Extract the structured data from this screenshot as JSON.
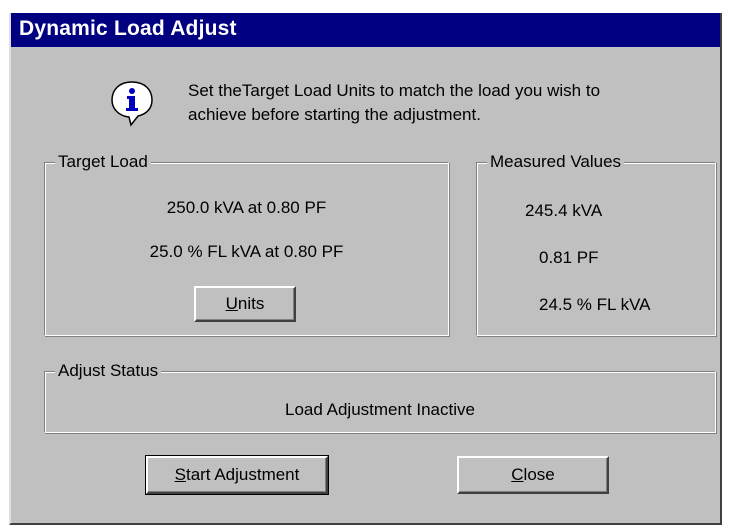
{
  "window": {
    "title": "Dynamic Load Adjust"
  },
  "instruction": {
    "icon": "info-icon",
    "line1": "Set theTarget Load Units to match the load you wish to",
    "line2": "achieve before starting the adjustment."
  },
  "target_load": {
    "label": "Target Load",
    "line1": "250.0 kVA at 0.80 PF",
    "line2": "25.0 % FL kVA at 0.80 PF",
    "units_button": {
      "accel": "U",
      "rest": "nits"
    }
  },
  "measured_values": {
    "label": "Measured Values",
    "kva": "245.4  kVA",
    "pf": "0.81  PF",
    "fl_kva": "24.5  %  FL  kVA"
  },
  "adjust_status": {
    "label": "Adjust Status",
    "text": "Load Adjustment Inactive"
  },
  "buttons": {
    "start": {
      "accel": "S",
      "rest": "tart Adjustment"
    },
    "close": {
      "accel": "C",
      "rest": "lose"
    }
  },
  "colors": {
    "titlebar": "#000080",
    "face": "#c0c0c0"
  }
}
